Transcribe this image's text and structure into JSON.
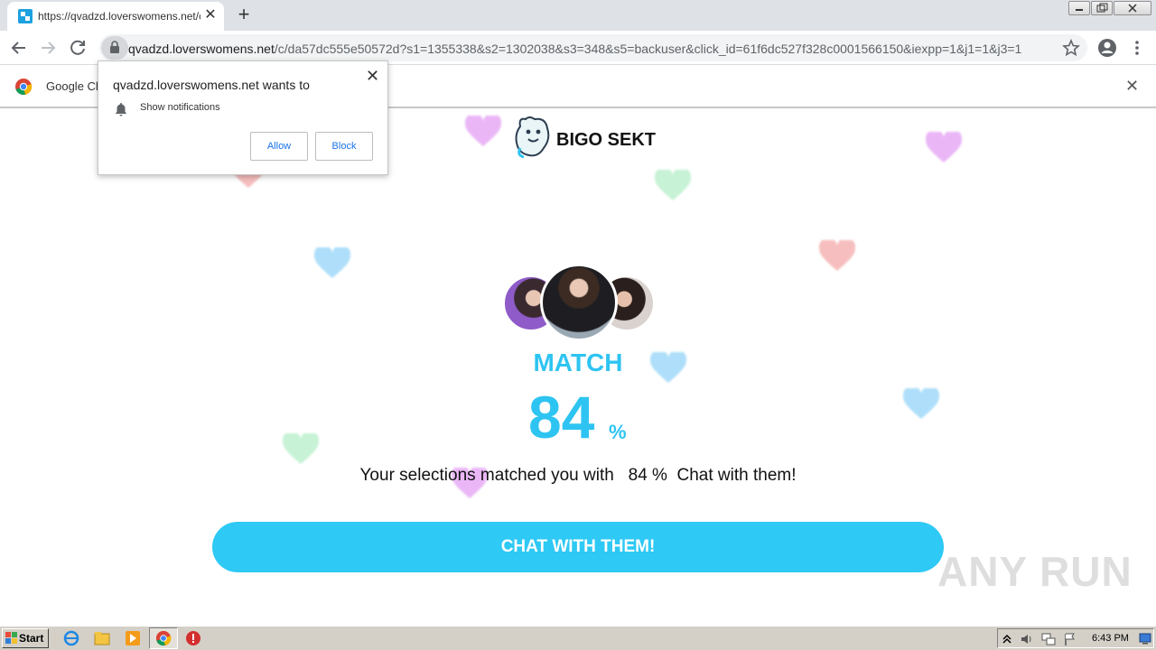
{
  "browser": {
    "tab_title": "https://qvadzd.loverswomens.net/c/",
    "url_host": "qvadzd.loverswomens.net",
    "url_path": "/c/da57dc555e50572d?s1=1355338&s2=1302038&s3=348&s5=backuser&click_id=61f6dc527f328c0001566150&iexpp=1&j1=1&j3=1",
    "new_tab": "+",
    "tab_close": "✕"
  },
  "infobar": {
    "label": "Google Ch",
    "close": "✕"
  },
  "permission_popup": {
    "heading": "qvadzd.loverswomens.net wants to",
    "item": "Show notifications",
    "allow": "Allow",
    "block": "Block",
    "close": "✕"
  },
  "page": {
    "brand": "BIGO SEKT",
    "match_label": "MATCH",
    "match_value": "84",
    "match_unit": "%",
    "match_line": "Your selections matched you with   84 %  Chat with them!",
    "cta": "CHAT WITH THEM!",
    "watermark": "ANY RUN"
  },
  "taskbar": {
    "start": "Start",
    "clock": "6:43 PM"
  },
  "colors": {
    "accent": "#2ec4f2",
    "cta": "#2ec9f5",
    "heart_pink": "#e08af0",
    "heart_blue": "#6cc4f5",
    "heart_green": "#9ae8b4",
    "heart_red": "#f08a8a"
  }
}
